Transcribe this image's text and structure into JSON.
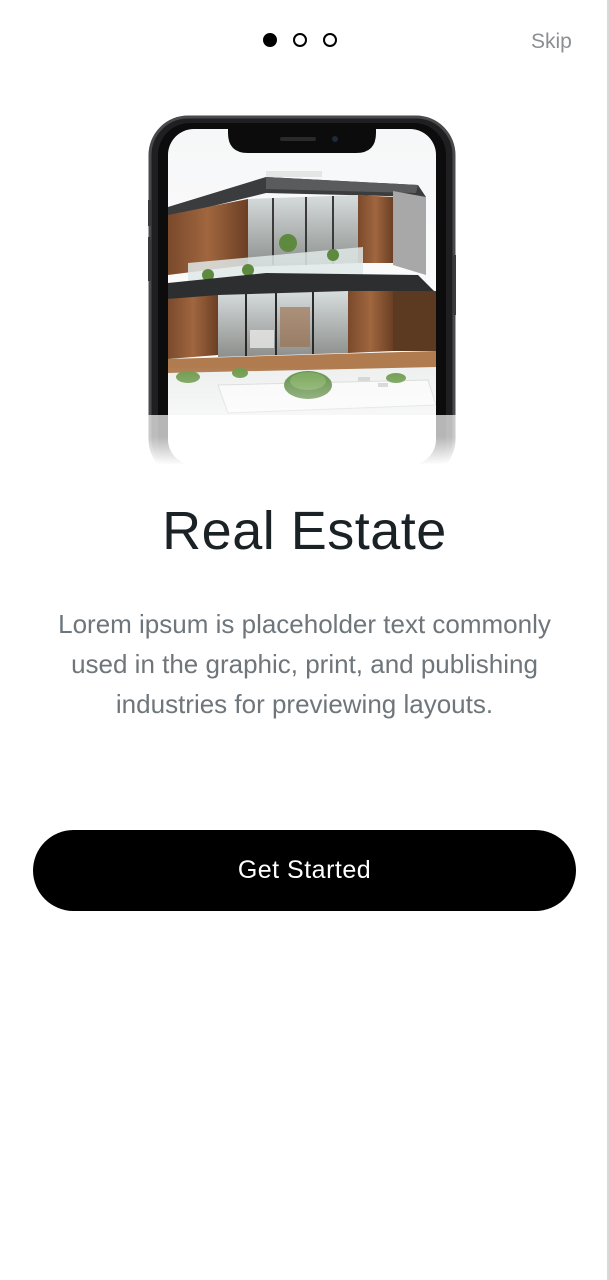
{
  "pager": {
    "total_pages": 3,
    "current_page": 1
  },
  "header": {
    "skip_label": "Skip"
  },
  "hero": {
    "image_subject": "modern house on phone mockup"
  },
  "content": {
    "title": "Real Estate",
    "description": "Lorem ipsum is placeholder text commonly used in the graphic, print, and publishing industries for previewing layouts."
  },
  "actions": {
    "primary_label": "Get Started"
  },
  "colors": {
    "primary": "#000000",
    "title_text": "#1b2226",
    "body_text": "#6e767b",
    "skip_text": "#8a8f93"
  }
}
